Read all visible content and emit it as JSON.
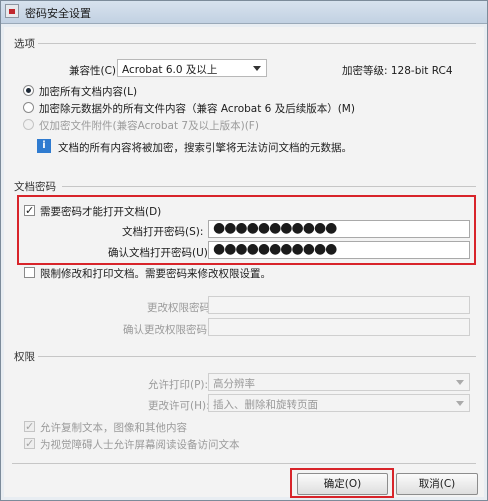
{
  "window": {
    "title": "密码安全设置"
  },
  "options": {
    "section_label": "选项",
    "compat_label": "兼容性(C):",
    "compat_value": "Acrobat 6.0 及以上",
    "encryption_level": "加密等级: 128-bit RC4",
    "radio_all": "加密所有文档内容(L)",
    "radio_except_meta": "加密除元数据外的所有文件内容（兼容 Acrobat 6 及后续版本）(M)",
    "radio_attachments": "仅加密文件附件(兼容Acrobat 7及以上版本)(F)",
    "info_text": "文档的所有内容将被加密，搜索引擎将无法访问文档的元数据。"
  },
  "open_password": {
    "section_label": "文档密码",
    "require_label": "需要密码才能打开文档(D)",
    "require_mark": "✓",
    "password_label": "文档打开密码(S):",
    "password_value": "●●●●●●●●●●●",
    "confirm_label": "确认文档打开密码(U):",
    "confirm_value": "●●●●●●●●●●●"
  },
  "restrict": {
    "label": "限制修改和打印文档。需要密码来修改权限设置。",
    "change_password_label": "更改权限密码:",
    "confirm_change_password_label": "确认更改权限密码:"
  },
  "permissions": {
    "section_label": "权限",
    "print_label": "允许打印(P):",
    "print_value": "高分辨率",
    "changes_label": "更改许可(H):",
    "changes_value": "插入、删除和旋转页面",
    "copy_label": "允许复制文本，图像和其他内容",
    "screen_reader_label": "为视觉障碍人士允许屏幕阅读设备访问文本",
    "check_mark": "✓"
  },
  "buttons": {
    "ok": "确定(O)",
    "cancel": "取消(C)"
  },
  "colors": {
    "highlight": "#d8242a",
    "info_icon": "#2f7bd0"
  }
}
